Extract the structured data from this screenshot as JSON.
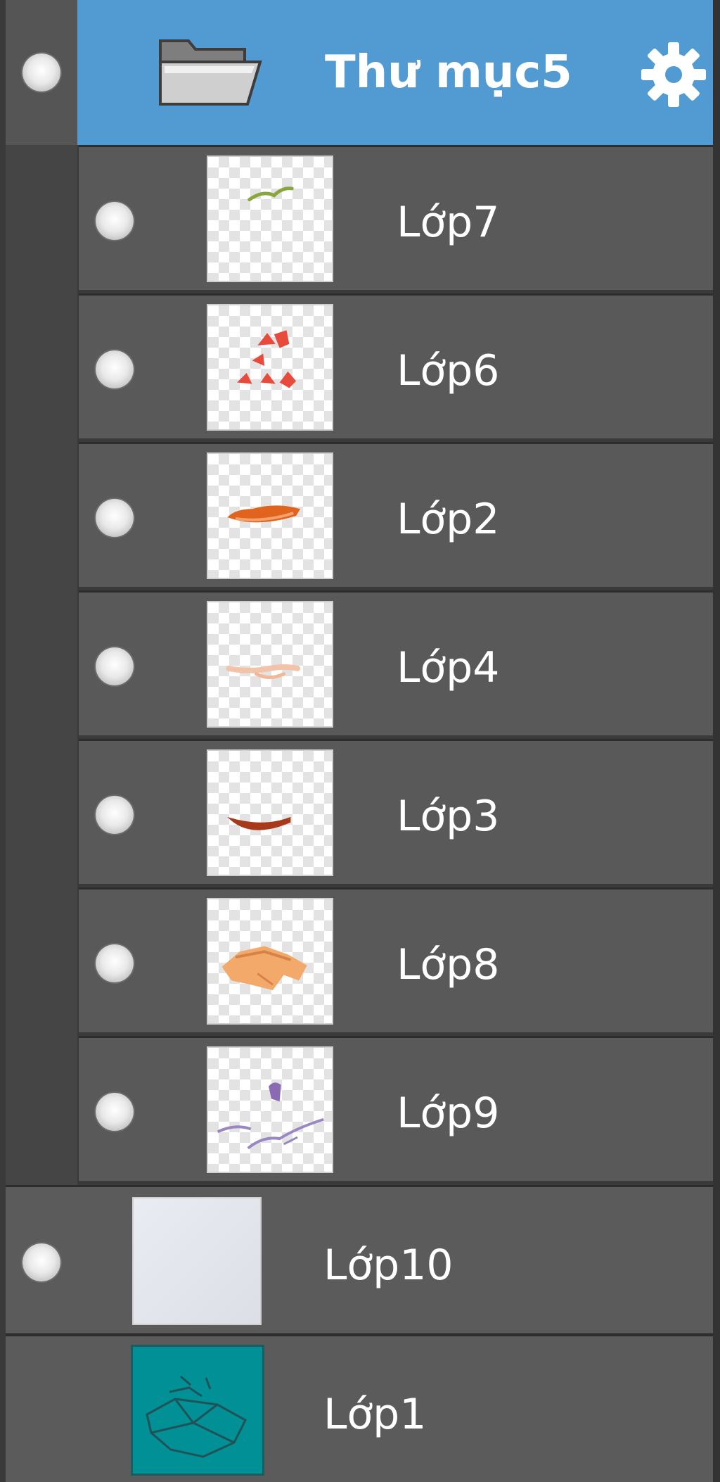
{
  "folder": {
    "title": "Thư mục5",
    "icon": "folder-icon",
    "settings_icon": "gear-icon",
    "accent": "#519bd2"
  },
  "layers": [
    {
      "label": "Lớp7",
      "thumb": "green-stroke"
    },
    {
      "label": "Lớp6",
      "thumb": "red-petals"
    },
    {
      "label": "Lớp2",
      "thumb": "orange-stroke"
    },
    {
      "label": "Lớp4",
      "thumb": "beige-stroke"
    },
    {
      "label": "Lớp3",
      "thumb": "dark-red-curve"
    },
    {
      "label": "Lớp8",
      "thumb": "orange-shape"
    },
    {
      "label": "Lớp9",
      "thumb": "purple-lines"
    }
  ],
  "bottom_layers": [
    {
      "label": "Lớp10",
      "thumb": "light-gray-fill"
    },
    {
      "label": "Lớp1",
      "thumb": "teal-sketch"
    }
  ]
}
